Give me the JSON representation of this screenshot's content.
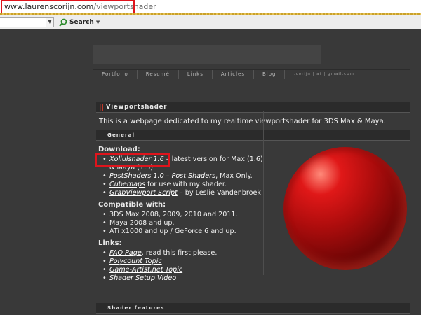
{
  "browser": {
    "url_domain": "www.laurenscorijn.com",
    "url_path": "/viewportshader",
    "search_label": "Search"
  },
  "nav": {
    "items": [
      "Portfolio",
      "Resumé",
      "Links",
      "Articles",
      "Blog"
    ],
    "email": "l.corijn | at | gmail.com"
  },
  "page": {
    "section_title": "Viewportshader",
    "intro": "This is a webpage dedicated to my realtime viewportshader for 3DS Max & Maya.",
    "general_title": "General",
    "download_heading": "Download:",
    "download_items": [
      {
        "link": "Xoliulshader 1.6",
        "rest": " – latest version for Max (1.6) & Maya (1.5)."
      },
      {
        "link": "PostShaders 1.0",
        "mid": " – ",
        "link2": "Post Shaders",
        "rest": ", Max Only."
      },
      {
        "link": "Cubemaps",
        "rest": " for use with my shader."
      },
      {
        "link": "GrabViewport Script",
        "rest": " – by Leslie Vandenbroek."
      }
    ],
    "compatible_heading": "Compatible with:",
    "compatible_items": [
      "3DS Max 2008, 2009, 2010 and 2011.",
      "Maya 2008 and up.",
      "ATi x1000 and up / GeForce 6 and up."
    ],
    "links_heading": "Links:",
    "links_items": [
      {
        "link": "FAQ Page",
        "rest": ", read this first please."
      },
      {
        "link": "Polycount Topic",
        "rest": ""
      },
      {
        "link": "Game-Artist.net Topic",
        "rest": ""
      },
      {
        "link": "Shader Setup Video",
        "rest": ""
      }
    ],
    "shader_features_title": "Shader features"
  },
  "colors": {
    "highlight": "#e0141c",
    "accent": "#c0392b"
  },
  "icons": {
    "search": "magnifier-icon"
  }
}
